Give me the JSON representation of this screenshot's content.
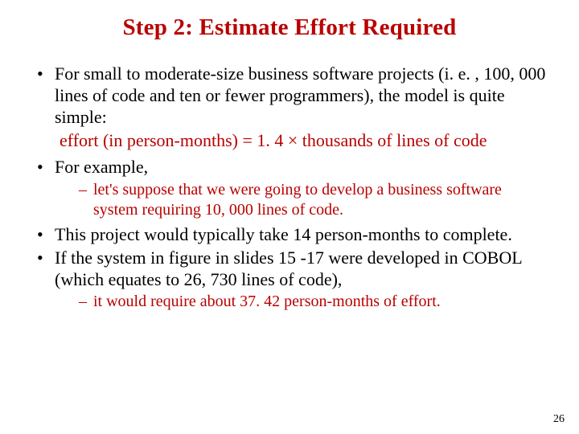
{
  "title": "Step 2: Estimate Effort Required",
  "bullets": {
    "b1": "For small to moderate-size business software projects (i. e. , 100, 000 lines of code and ten or fewer programmers), the model is quite simple:",
    "formula": "effort (in person-months) = 1. 4 × thousands of lines of code",
    "b2": "For example,",
    "b2_sub1": "let's suppose that we were going to develop a business software system requiring 10, 000 lines of code.",
    "b3": "This project would typically take 14 person-months to complete.",
    "b4": "If the system in figure in slides 15 -17 were developed in COBOL (which equates to 26, 730 lines of code),",
    "b4_sub1": "it would require about 37. 42 person-months of effort."
  },
  "page_number": "26"
}
